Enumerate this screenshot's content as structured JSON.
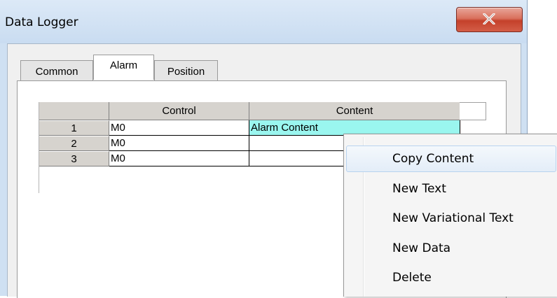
{
  "window": {
    "title": "Data Logger"
  },
  "tabs": [
    {
      "label": "Common"
    },
    {
      "label": "Alarm"
    },
    {
      "label": "Position"
    }
  ],
  "grid": {
    "columns": [
      "",
      "Control",
      "Content"
    ],
    "rows": [
      {
        "index": "1",
        "control": "M0",
        "content": "Alarm Content"
      },
      {
        "index": "2",
        "control": "M0",
        "content": ""
      },
      {
        "index": "3",
        "control": "M0",
        "content": ""
      }
    ]
  },
  "context_menu": {
    "items": [
      {
        "label": "Copy Content"
      },
      {
        "label": "New Text"
      },
      {
        "label": "New Variational Text"
      },
      {
        "label": "New Data"
      },
      {
        "label": "Delete"
      }
    ]
  },
  "colors": {
    "selected_cell": "#9af6ef",
    "close_button": "#c4412b"
  }
}
